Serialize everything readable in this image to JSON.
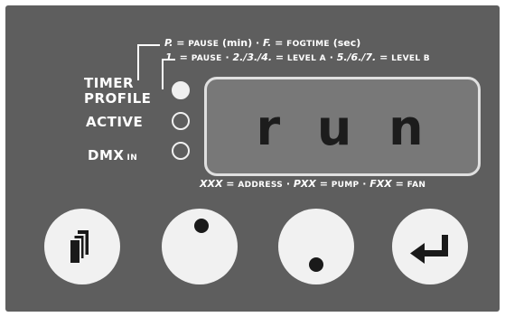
{
  "labels": {
    "timer": "TIMER",
    "profile": "PROFILE",
    "active": "ACTIVE",
    "dmx": "DMX",
    "dmx_sub": "IN"
  },
  "legend_top": {
    "p": "P.",
    "eq1": " = ",
    "pause_min_sc": "PAUSE",
    "pause_min_tail": " (min) · ",
    "f": "F.",
    "eq2": " = ",
    "fogtime_sc": "FOGTIME",
    "fogtime_tail": " (sec)"
  },
  "legend_mid": {
    "one": "1.",
    "eq1": " = ",
    "pause_sc": "PAUSE",
    "sep1": " · ",
    "two_four": "2./3./4.",
    "eq2": " = ",
    "level_a_sc": "LEVEL A",
    "sep2": " · ",
    "five_seven": "5./6./7.",
    "eq3": " = ",
    "level_b_sc": "LEVEL B"
  },
  "legend_bottom": {
    "xxx": "XXX",
    "eq1": " = ",
    "address_sc": "ADDRESS",
    "sep1": " · ",
    "pxx": "PXX",
    "eq2": " = ",
    "pump_sc": "PUMP",
    "sep2": " · ",
    "fxx": "FXX",
    "eq3": " = ",
    "fan_sc": "FAN"
  },
  "display": {
    "text": "r u n"
  },
  "leds": {
    "profile": "on",
    "active": "off",
    "dmx": "off"
  },
  "buttons": {
    "menu_icon": "stacked-pages-icon",
    "down_icon": "knob-dot-upper-left",
    "up_icon": "knob-dot-lower-right",
    "enter_icon": "enter-arrow-icon"
  },
  "colors": {
    "panel": "#5e5e5e",
    "led_on": "#f0f0f0",
    "button": "#f1f1f1",
    "display_bg": "#787878",
    "display_text": "#1c1c1c"
  }
}
